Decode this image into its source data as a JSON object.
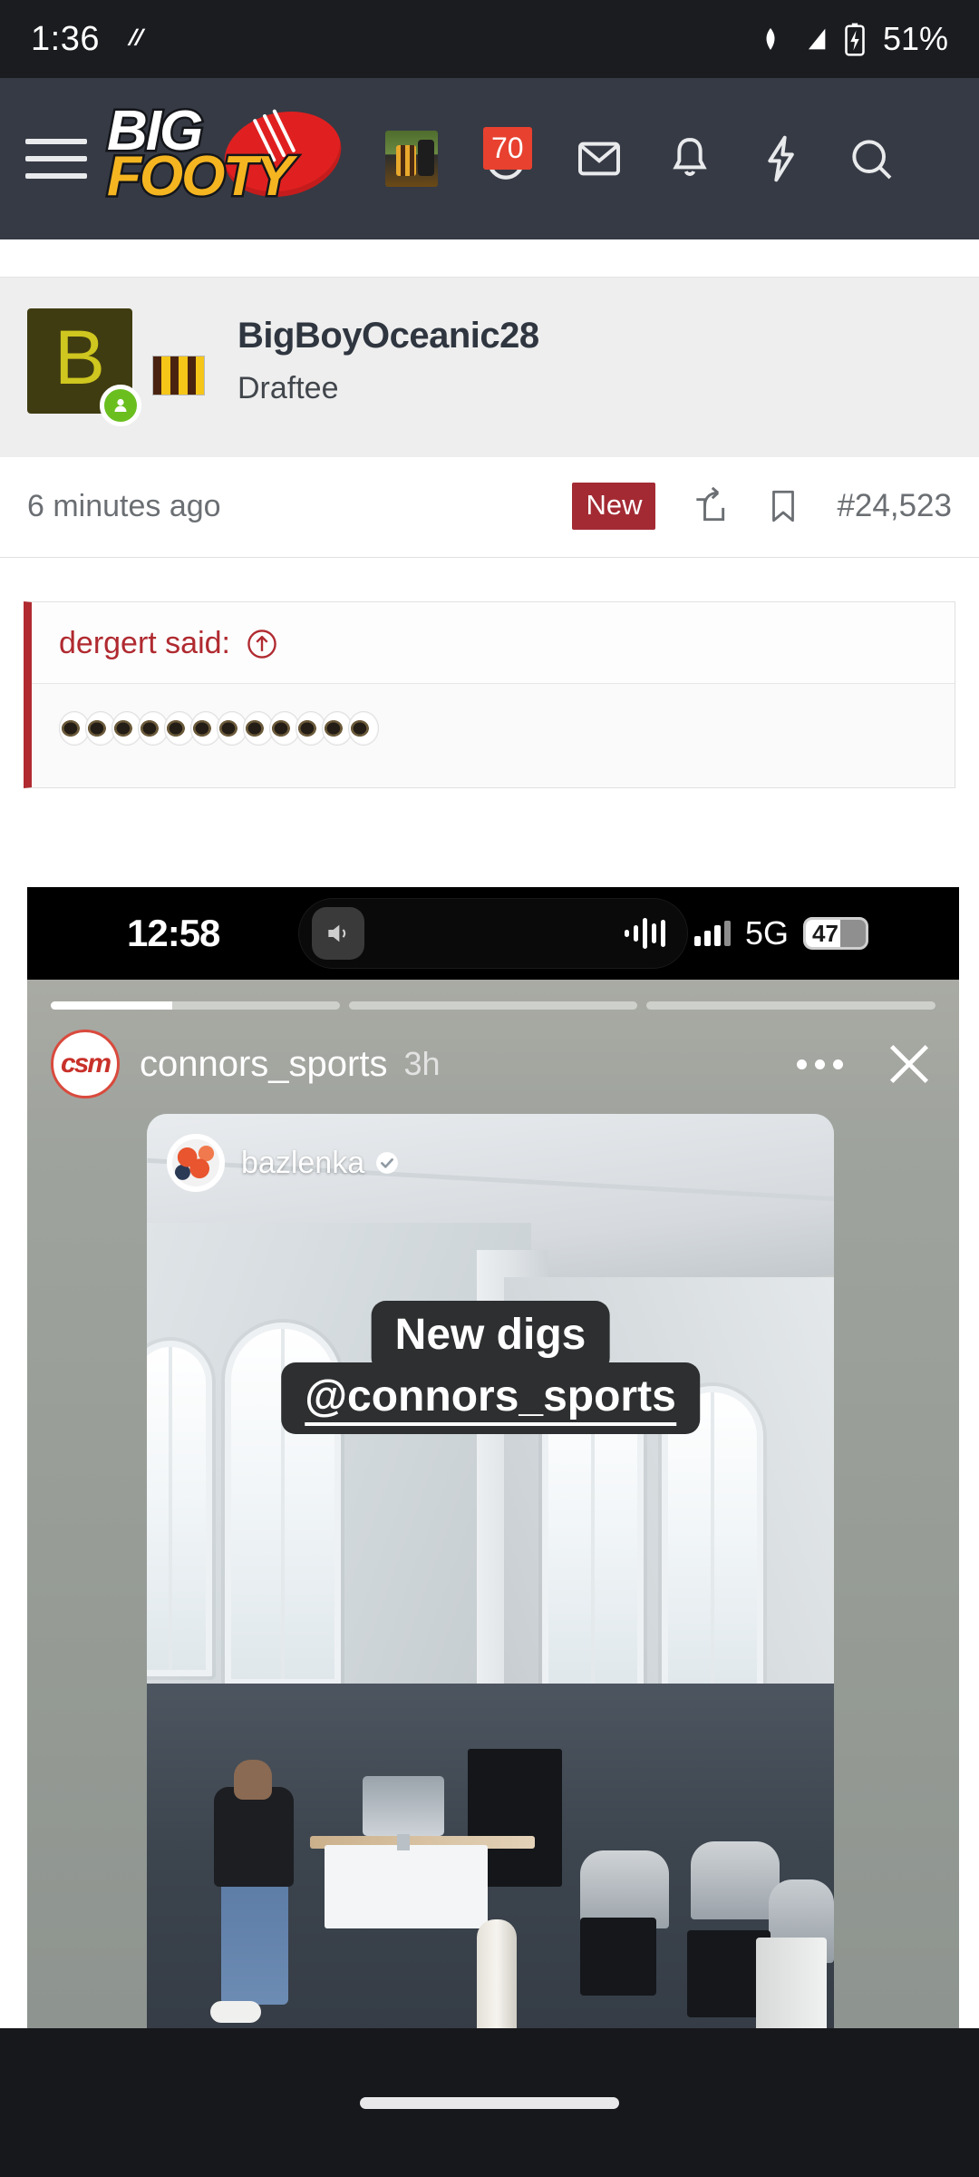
{
  "status_bar": {
    "time": "1:36",
    "battery_percent": "51%",
    "icons": [
      "app-notification-icon",
      "wifi-icon",
      "cell-signal-icon",
      "battery-charging-icon"
    ]
  },
  "navbar": {
    "menu_icon": "hamburger-menu-icon",
    "logo": {
      "line1": "BIG",
      "line2": "FOOTY"
    },
    "notification_count": "70",
    "icons": [
      "user-avatar",
      "alerts-icon",
      "inbox-icon",
      "bell-icon",
      "whats-new-icon",
      "search-icon"
    ]
  },
  "post": {
    "avatar_letter": "B",
    "username": "BigBoyOceanic28",
    "user_title": "Draftee",
    "timestamp": "6 minutes ago",
    "new_badge": "New",
    "post_number": "#24,523",
    "share_icon": "share-icon",
    "bookmark_icon": "bookmark-icon",
    "online_status": "online"
  },
  "quote": {
    "author_label": "dergert said:",
    "jump_icon": "jump-to-post-icon",
    "body_emoji": "eyes-emoji",
    "emoji_count": 12
  },
  "embedded_screenshot": {
    "ios_status": {
      "time": "12:58",
      "network": "5G",
      "battery": "47",
      "dynamic_island": [
        "speaker-icon",
        "audio-waveform-icon"
      ]
    },
    "story": {
      "account": "connors_sports",
      "time_ago": "3h",
      "avatar_label": "csm",
      "more_icon": "more-options-icon",
      "close_icon": "close-icon",
      "progress_segments": 3,
      "progress_active_index": 0,
      "progress_active_fill": 42,
      "reposted": {
        "account": "bazlenka",
        "verified": true,
        "caption_line1": "New digs",
        "caption_line2": "@connors_sports"
      }
    }
  },
  "nav_gesture": {
    "label": "home-gesture-pill"
  },
  "colors": {
    "status_bar_bg": "#1b1c20",
    "navbar_bg": "#363a45",
    "brand_gold": "#f5b521",
    "brand_red": "#e02020",
    "badge_red": "#e8412f",
    "new_badge_red": "#a32a33",
    "quote_accent": "#b02a30",
    "online_green": "#6abf1f",
    "avatar_olive": "#403c11"
  }
}
